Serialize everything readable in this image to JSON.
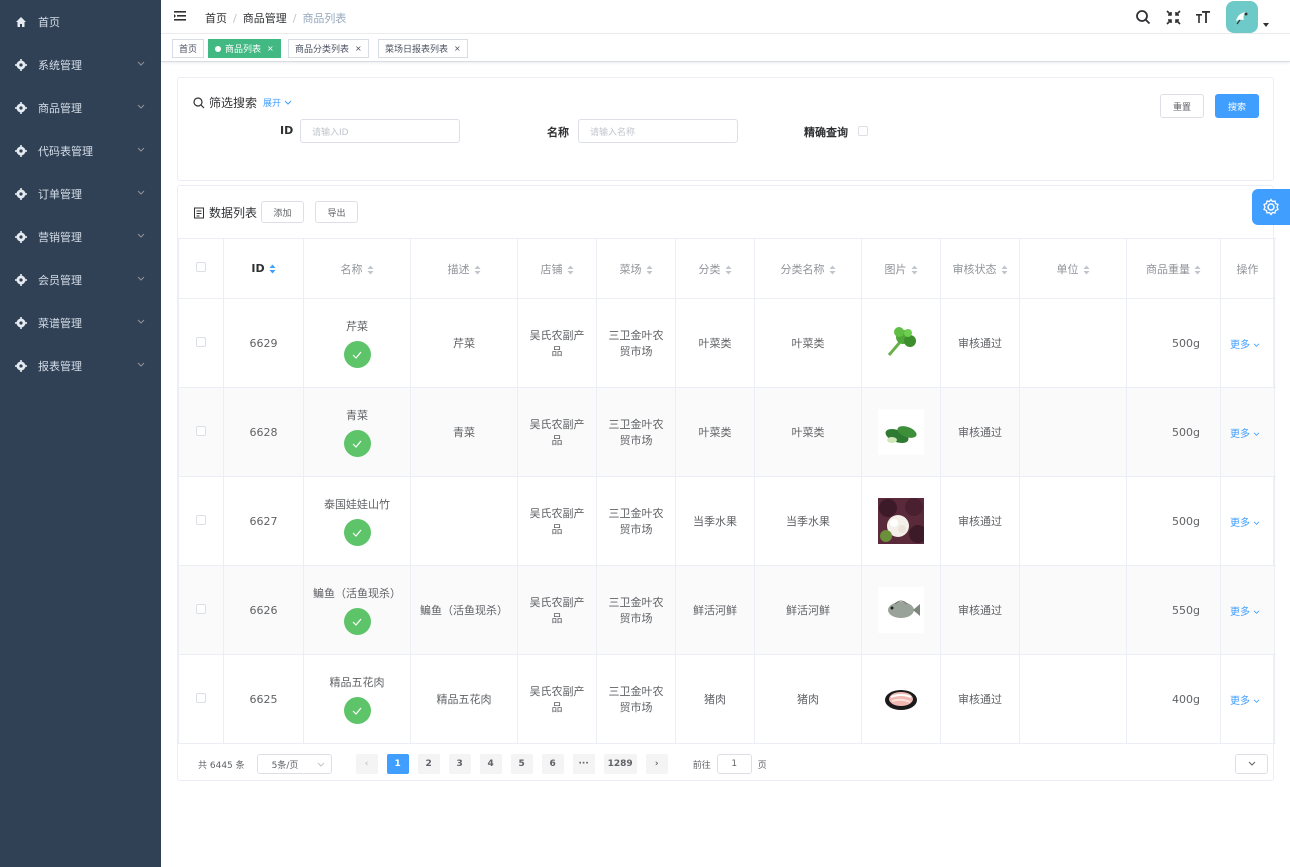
{
  "sidebar": {
    "items": [
      {
        "label": "首页",
        "icon": "home-icon"
      },
      {
        "label": "系统管理",
        "icon": "settings-icon"
      },
      {
        "label": "商品管理",
        "icon": "settings-icon"
      },
      {
        "label": "代码表管理",
        "icon": "settings-icon"
      },
      {
        "label": "订单管理",
        "icon": "settings-icon"
      },
      {
        "label": "营销管理",
        "icon": "settings-icon"
      },
      {
        "label": "会员管理",
        "icon": "settings-icon"
      },
      {
        "label": "菜谱管理",
        "icon": "settings-icon"
      },
      {
        "label": "报表管理",
        "icon": "settings-icon"
      }
    ]
  },
  "header": {
    "breadcrumb": [
      "首页",
      "商品管理",
      "商品列表"
    ],
    "icons": [
      "search-icon",
      "fullscreen-exit-icon",
      "font-size-icon"
    ]
  },
  "tags": [
    {
      "label": "首页"
    },
    {
      "label": "商品列表"
    },
    {
      "label": "商品分类列表"
    },
    {
      "label": "菜场日报表列表"
    }
  ],
  "filter": {
    "title": "筛选搜索",
    "expand": "展开",
    "id_label": "ID",
    "id_placeholder": "请输入ID",
    "name_label": "名称",
    "name_placeholder": "请输入名称",
    "exact_label": "精确查询",
    "reset": "重置",
    "search": "搜索"
  },
  "list": {
    "title": "数据列表",
    "add": "添加",
    "export": "导出",
    "columns": [
      "ID",
      "名称",
      "描述",
      "店铺",
      "菜场",
      "分类",
      "分类名称",
      "图片",
      "审核状态",
      "单位",
      "商品重量",
      "操作"
    ],
    "rows": [
      {
        "id": "6629",
        "name": "芹菜",
        "desc": "芹菜",
        "shop": "吴氏农副产品",
        "market": "三卫金叶农贸市场",
        "cat": "叶菜类",
        "cat_name": "叶菜类",
        "status": "审核通过",
        "unit": "",
        "weight": "500g",
        "action": "更多",
        "pic": "celery-image"
      },
      {
        "id": "6628",
        "name": "青菜",
        "desc": "青菜",
        "shop": "吴氏农副产品",
        "market": "三卫金叶农贸市场",
        "cat": "叶菜类",
        "cat_name": "叶菜类",
        "status": "审核通过",
        "unit": "",
        "weight": "500g",
        "action": "更多",
        "pic": "bok-choy-image"
      },
      {
        "id": "6627",
        "name": "泰国娃娃山竹",
        "desc": "",
        "shop": "吴氏农副产品",
        "market": "三卫金叶农贸市场",
        "cat": "当季水果",
        "cat_name": "当季水果",
        "status": "审核通过",
        "unit": "",
        "weight": "500g",
        "action": "更多",
        "pic": "mangosteen-image"
      },
      {
        "id": "6626",
        "name": "鳊鱼（活鱼现杀）",
        "desc": "鳊鱼（活鱼现杀）",
        "shop": "吴氏农副产品",
        "market": "三卫金叶农贸市场",
        "cat": "鲜活河鲜",
        "cat_name": "鲜活河鲜",
        "status": "审核通过",
        "unit": "",
        "weight": "550g",
        "action": "更多",
        "pic": "fish-image"
      },
      {
        "id": "6625",
        "name": "精品五花肉",
        "desc": "精品五花肉",
        "shop": "吴氏农副产品",
        "market": "三卫金叶农贸市场",
        "cat": "猪肉",
        "cat_name": "猪肉",
        "status": "审核通过",
        "unit": "",
        "weight": "400g",
        "action": "更多",
        "pic": "pork-image"
      }
    ]
  },
  "pagination": {
    "total": "共 6445 条",
    "page_size": "5条/页",
    "pages": [
      "1",
      "2",
      "3",
      "4",
      "5",
      "6",
      "···",
      "1289"
    ],
    "goto_label": "前往",
    "goto_value": "1",
    "page_unit": "页"
  },
  "colors": {
    "sidebar": "#304156",
    "primary": "#409eff",
    "tag_active": "#42b983",
    "success": "#5ec46a"
  }
}
